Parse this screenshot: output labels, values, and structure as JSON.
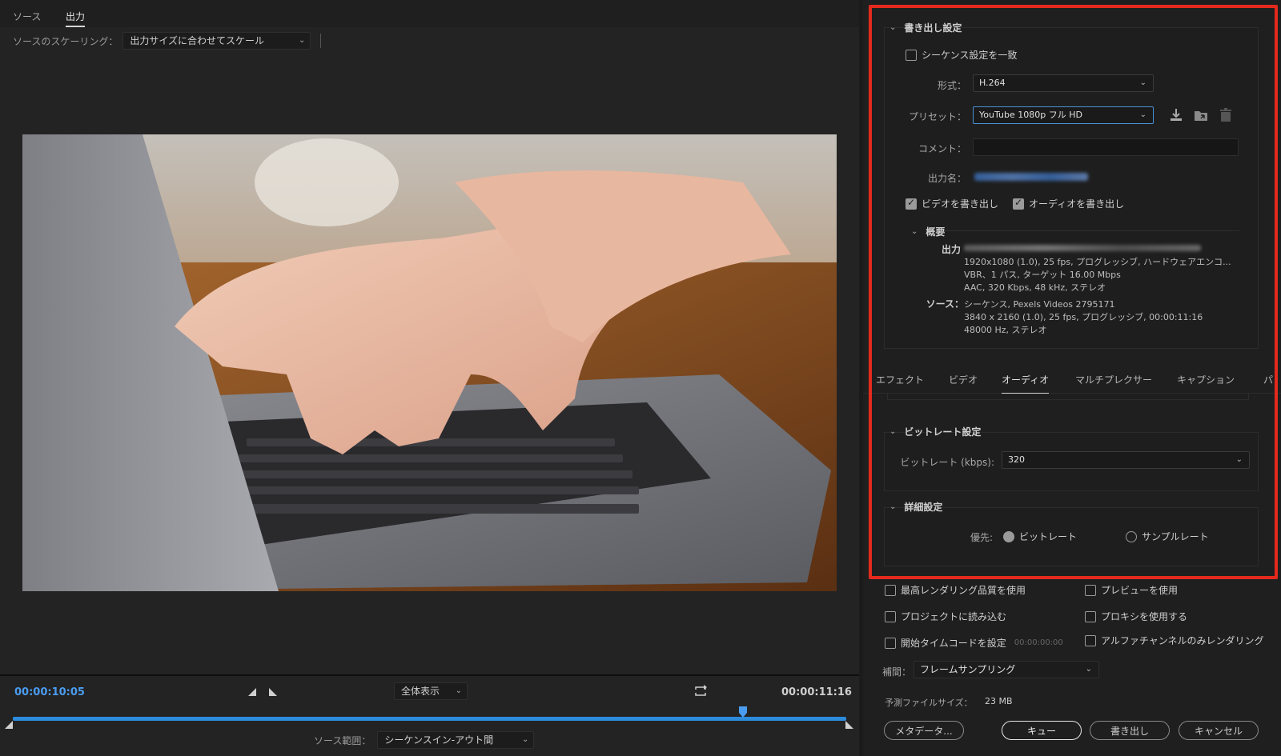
{
  "source_tabs": {
    "source": "ソース",
    "output": "出力"
  },
  "scaling": {
    "label": "ソースのスケーリング：",
    "value": "出力サイズに合わせてスケール"
  },
  "timeline": {
    "current_tc": "00:00:10:05",
    "duration_tc": "00:00:11:16",
    "fit": "全体表示",
    "range_label": "ソース範囲：",
    "range_value": "シーケンスイン-アウト間",
    "playhead_fraction": 0.882
  },
  "export": {
    "title": "書き出し設定",
    "match_seq": "シーケンス設定を一致",
    "format_label": "形式：",
    "format_value": "H.264",
    "preset_label": "プリセット：",
    "preset_value": "YouTube 1080p フル HD",
    "comment_label": "コメント：",
    "output_name_label": "出力名：",
    "export_video": "ビデオを書き出し",
    "export_audio": "オーディオを書き出し",
    "summary_title": "概要",
    "output_key": "出力",
    "output_lines": [
      "1920x1080 (1.0), 25 fps, プログレッシブ, ハードウェアエンコ...",
      "VBR、1 パス, ターゲット 16.00 Mbps",
      "AAC, 320 Kbps, 48 kHz, ステレオ"
    ],
    "source_key": "ソース：",
    "source_lines": [
      "シーケンス, Pexels Videos 2795171",
      "3840 x 2160 (1.0), 25 fps, プログレッシブ, 00:00:11:16",
      "48000 Hz, ステレオ"
    ]
  },
  "tabs": [
    "エフェクト",
    "ビデオ",
    "オーディオ",
    "マルチプレクサー",
    "キャプション",
    "パ"
  ],
  "bitrate": {
    "title": "ビットレート設定",
    "label": "ビットレート (kbps):",
    "value": "320"
  },
  "advanced": {
    "title": "詳細設定",
    "priority_label": "優先:",
    "opt_bitrate": "ビットレート",
    "opt_samplerate": "サンプルレート"
  },
  "options": {
    "max_quality": "最高レンダリング品質を使用",
    "use_preview": "プレビューを使用",
    "import_project": "プロジェクトに読み込む",
    "use_proxy": "プロキシを使用する",
    "set_start_tc": "開始タイムコードを設定",
    "start_tc_value": "00:00:00:00",
    "alpha_only": "アルファチャンネルのみレンダリング",
    "interp_label": "補間：",
    "interp_value": "フレームサンプリング",
    "filesize_label": "予測ファイルサイズ：",
    "filesize_value": "23 MB"
  },
  "buttons": {
    "metadata": "メタデータ...",
    "queue": "キュー",
    "export": "書き出し",
    "cancel": "キャンセル"
  },
  "colors": {
    "accent": "#2d8bdc",
    "highlight": "#e32a1d",
    "timecode": "#4a9cf0"
  }
}
